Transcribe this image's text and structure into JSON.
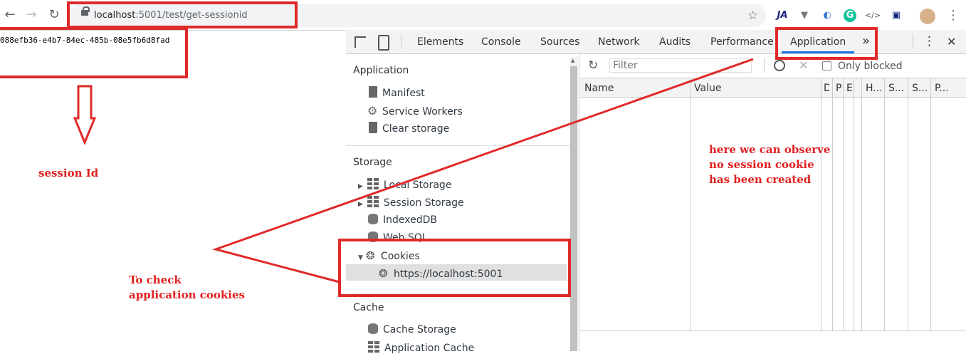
{
  "browser": {
    "url_host": "localhost",
    "url_path": ":5001/test/get-sessionid",
    "nav": {
      "back": "←",
      "forward": "→",
      "reload": "↻"
    },
    "extensions": [
      "JA",
      "▼",
      "◐",
      "G",
      "</>",
      "▣"
    ],
    "menu": "⋮",
    "star": "☆"
  },
  "page": {
    "session_text": "088efb36-e4b7-84ec-485b-08e5fb6d8fad"
  },
  "devtools": {
    "tabs": [
      "Elements",
      "Console",
      "Sources",
      "Network",
      "Audits",
      "Performance",
      "Application"
    ],
    "more_tabs": "»",
    "kebab": "⋮",
    "close": "✕",
    "sidebar": {
      "application_title": "Application",
      "application_items": [
        "Manifest",
        "Service Workers",
        "Clear storage"
      ],
      "storage_title": "Storage",
      "storage_items": [
        "Local Storage",
        "Session Storage",
        "IndexedDB",
        "Web SQL",
        "Cookies"
      ],
      "cookie_origin": "https://localhost:5001",
      "cache_title": "Cache",
      "cache_items": [
        "Cache Storage",
        "Application Cache"
      ]
    },
    "filter": {
      "placeholder": "Filter",
      "only_blocked": "Only blocked"
    },
    "table_headers": [
      "Name",
      "Value",
      "D",
      "P",
      "E",
      "",
      "H...",
      "S...",
      "S...",
      "P..."
    ]
  },
  "annotations": {
    "session_id": "session Id",
    "check_cookies_line1": "To check",
    "check_cookies_line2": "application cookies",
    "observe_line1": "here we can observe",
    "observe_line2": "no session cookie",
    "observe_line3": "has been created"
  },
  "colors": {
    "annotation_red": "#e02020",
    "active_tab": "#1a73e8"
  }
}
